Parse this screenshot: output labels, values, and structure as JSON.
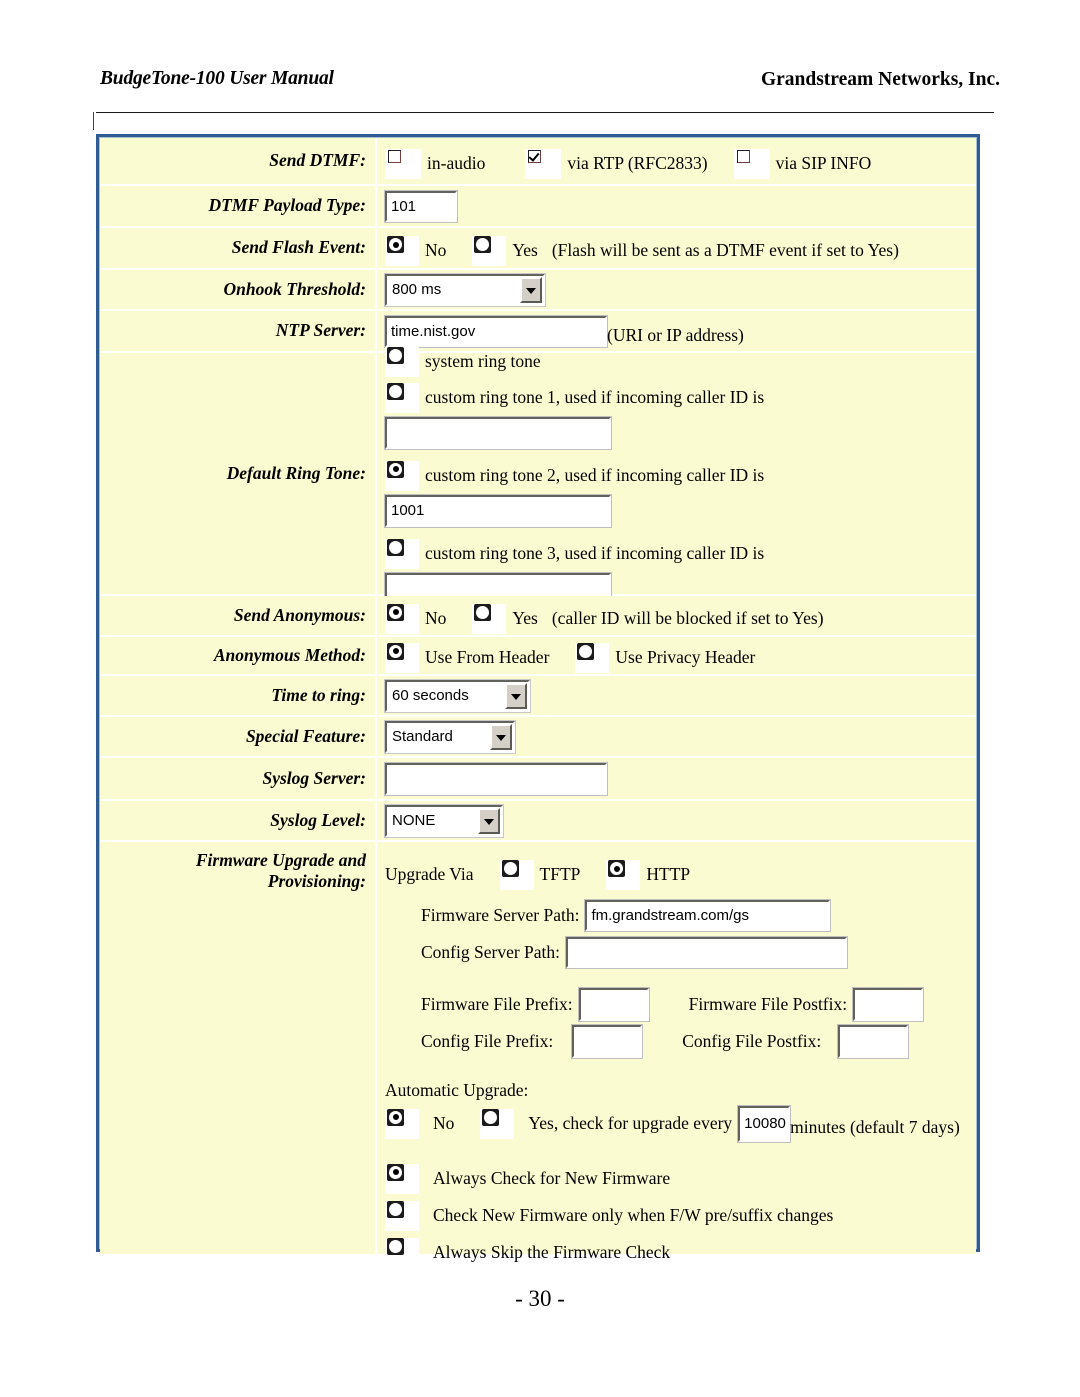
{
  "header": {
    "left_title": "BudgeTone-100 User Manual",
    "right_title": "Grandstream Networks, Inc."
  },
  "footer": {
    "page_number": "- 30 -"
  },
  "colors": {
    "frame_border": "#2e5c93",
    "table_background": "#fbfbd2",
    "row_divider": "#ffffff",
    "control_face": "#d4d0c8"
  },
  "form": {
    "send_dtmf": {
      "label": "Send DTMF:",
      "options": [
        {
          "text": "in-audio",
          "checked": false
        },
        {
          "text": "via RTP (RFC2833)",
          "checked": true
        },
        {
          "text": "via SIP INFO",
          "checked": false
        }
      ]
    },
    "dtmf_payload_type": {
      "label": "DTMF Payload Type:",
      "value": "101"
    },
    "send_flash_event": {
      "label": "Send Flash Event:",
      "options": [
        {
          "text": "No",
          "selected": true
        },
        {
          "text": "Yes",
          "selected": false
        }
      ],
      "note": "(Flash will be sent as a DTMF event if set to Yes)"
    },
    "onhook_threshold": {
      "label": "Onhook Threshold:",
      "value": "800 ms"
    },
    "ntp_server": {
      "label": "NTP Server:",
      "value": "time.nist.gov",
      "note": "(URI or IP address)"
    },
    "default_ring_tone": {
      "label": "Default Ring Tone:",
      "options": [
        {
          "text": "system ring tone",
          "selected": false,
          "has_input": false,
          "input_value": ""
        },
        {
          "text": "custom ring tone 1, used if incoming caller ID is",
          "selected": false,
          "has_input": true,
          "input_value": ""
        },
        {
          "text": "custom ring tone 2, used if incoming caller ID is",
          "selected": true,
          "has_input": true,
          "input_value": "1001"
        },
        {
          "text": "custom ring tone 3, used if incoming caller ID is",
          "selected": false,
          "has_input": true,
          "input_value": ""
        }
      ]
    },
    "send_anonymous": {
      "label": "Send Anonymous:",
      "options": [
        {
          "text": "No",
          "selected": true
        },
        {
          "text": "Yes",
          "selected": false
        }
      ],
      "note": "(caller ID will be blocked if set to Yes)"
    },
    "anonymous_method": {
      "label": "Anonymous Method:",
      "options": [
        {
          "text": "Use From Header",
          "selected": true
        },
        {
          "text": "Use Privacy Header",
          "selected": false
        }
      ]
    },
    "time_to_ring": {
      "label": "Time to ring:",
      "value": "60 seconds"
    },
    "special_feature": {
      "label": "Special Feature:",
      "value": "Standard"
    },
    "syslog_server": {
      "label": "Syslog Server:",
      "value": ""
    },
    "syslog_level": {
      "label": "Syslog Level:",
      "value": "NONE"
    },
    "firmware": {
      "label_line1": "Firmware Upgrade and",
      "label_line2": "Provisioning:",
      "upgrade_via_label": "Upgrade Via",
      "upgrade_via_options": [
        {
          "text": "TFTP",
          "selected": false
        },
        {
          "text": "HTTP",
          "selected": true
        }
      ],
      "firmware_server_path": {
        "label": "Firmware Server Path:",
        "value": "fm.grandstream.com/gs"
      },
      "config_server_path": {
        "label": "Config Server Path:",
        "value": ""
      },
      "firmware_file_prefix": {
        "label": "Firmware File Prefix:",
        "value": ""
      },
      "firmware_file_postfix": {
        "label": "Firmware File Postfix:",
        "value": ""
      },
      "config_file_prefix": {
        "label": "Config File Prefix:",
        "value": ""
      },
      "config_file_postfix": {
        "label": "Config File Postfix:",
        "value": ""
      },
      "automatic_upgrade_label": "Automatic Upgrade:",
      "automatic_upgrade_options": [
        {
          "text": "No",
          "selected": true
        },
        {
          "text": "Yes, check for upgrade every",
          "selected": false
        }
      ],
      "interval_value": "10080",
      "interval_suffix": "minutes (default 7 days)",
      "check_options": [
        {
          "text": "Always Check for New Firmware",
          "selected": true
        },
        {
          "text": "Check New Firmware only when F/W pre/suffix changes",
          "selected": false
        },
        {
          "text": "Always Skip the Firmware Check",
          "selected": false
        }
      ]
    }
  }
}
